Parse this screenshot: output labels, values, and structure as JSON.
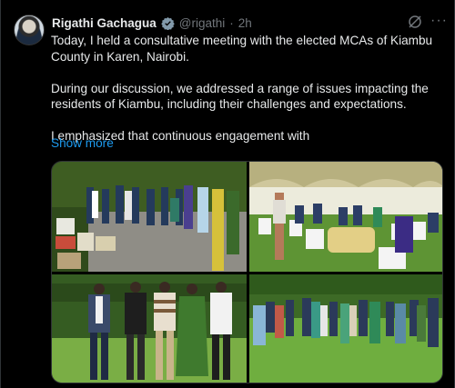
{
  "tweet": {
    "author_name": "Rigathi Gachagua",
    "handle": "@rigathi",
    "separator": "·",
    "time": "2h",
    "paragraphs": [
      "Today, I held a consultative meeting with the elected MCAs of Kiambu County in Karen, Nairobi.",
      "During our discussion, we addressed a range of issues impacting the residents of Kiambu, including their challenges and expectations.",
      "I emphasized that continuous engagement with"
    ],
    "show_more": "Show more"
  },
  "icons": {
    "verified": "verified-badge-icon",
    "grok": "grok-icon",
    "more": "more-options-icon"
  },
  "colors": {
    "background": "#000000",
    "text": "#e7e9ea",
    "secondary": "#71767b",
    "link": "#1d9bf0"
  },
  "media": {
    "photos": [
      "group-outdoor-with-gifts",
      "meeting-under-tent",
      "five-men-standing-on-lawn",
      "large-group-photo-on-lawn"
    ]
  }
}
